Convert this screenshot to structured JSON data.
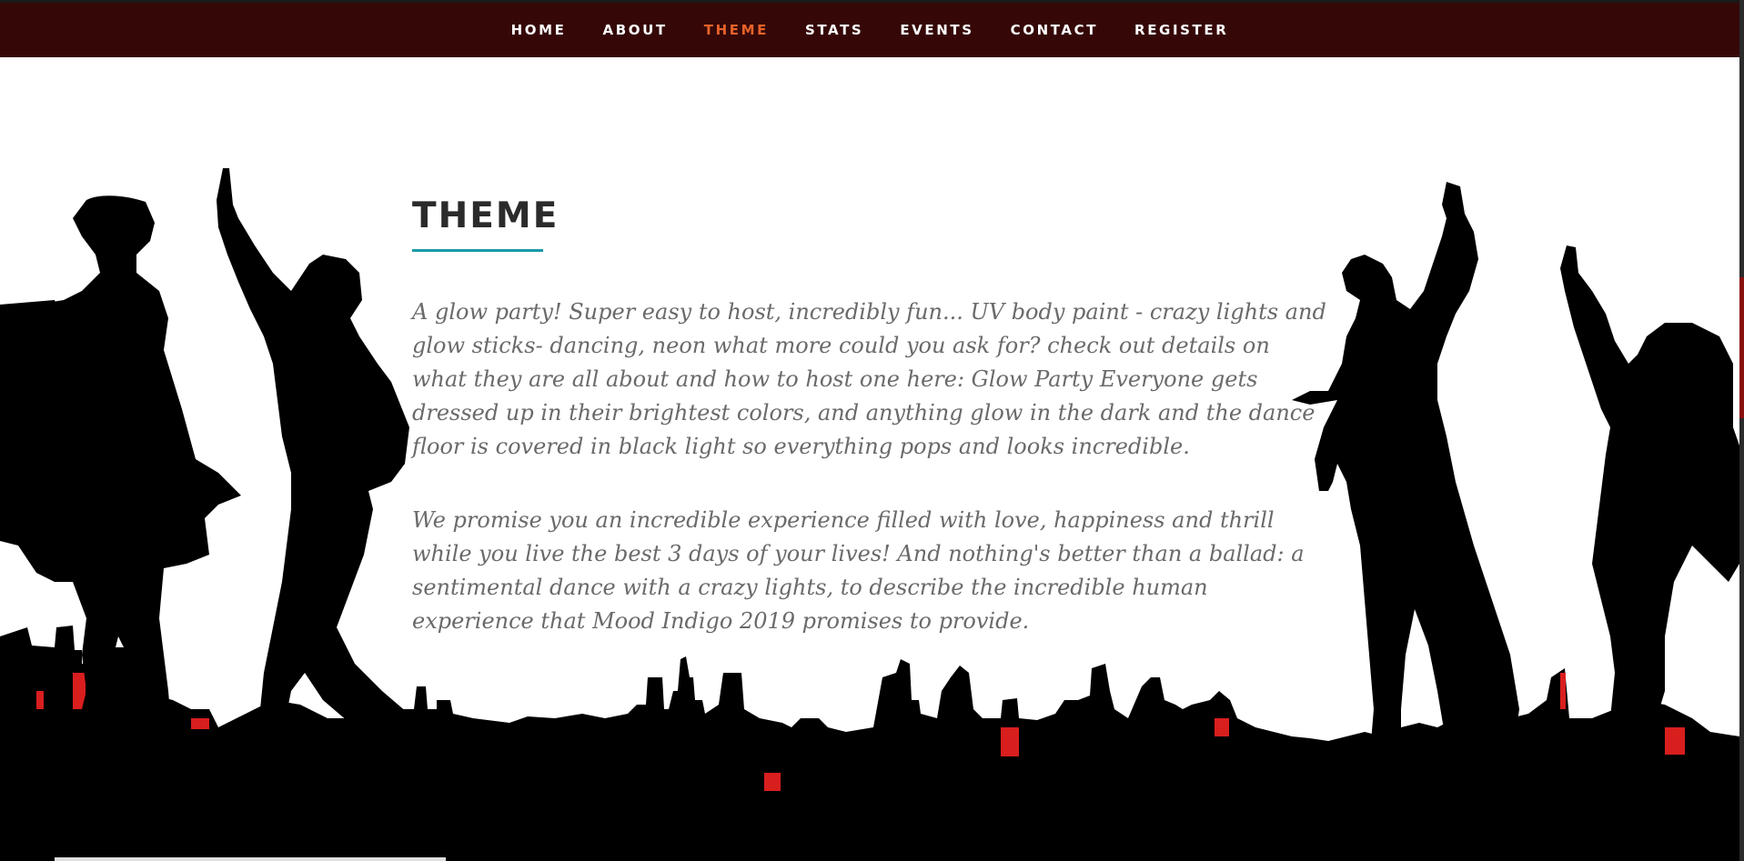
{
  "nav": {
    "items": [
      {
        "label": "HOME",
        "active": false
      },
      {
        "label": "ABOUT",
        "active": false
      },
      {
        "label": "THEME",
        "active": true
      },
      {
        "label": "STATS",
        "active": false
      },
      {
        "label": "EVENTS",
        "active": false
      },
      {
        "label": "CONTACT",
        "active": false
      },
      {
        "label": "REGISTER",
        "active": false
      }
    ],
    "background": "#350807",
    "active_color": "#e8622a"
  },
  "theme": {
    "title": "THEME",
    "underline_color": "#1a9aa8",
    "paragraph1": "A glow party! Super easy to host, incredibly fun... UV body paint - crazy lights and glow sticks- dancing, neon what more could you ask for? check out details on what they are all about and how to host one here: Glow Party Everyone gets dressed up in their brightest colors, and anything glow in the dark and the dance floor is covered in black light so everything pops and looks incredible.",
    "paragraph2": "We promise you an incredible experience filled with love, happiness and thrill while you live the best 3 days of your lives! And nothing's better than a ballad: a sentimental dance with a crazy lights, to describe the incredible human experience that Mood Indigo 2019 promises to provide."
  },
  "background_art": {
    "description_icon": "dancers-silhouette-cityscape",
    "silhouette_color": "#000000",
    "accent_color": "#d91e1e"
  }
}
